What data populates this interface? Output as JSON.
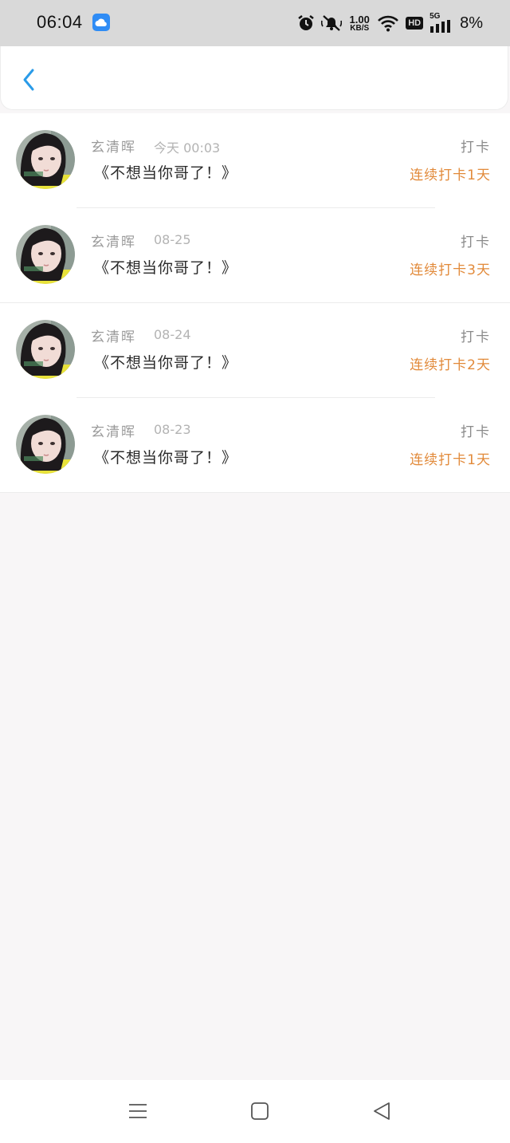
{
  "status_bar": {
    "time": "06:04",
    "net_speed_value": "1.00",
    "net_speed_unit": "KB/S",
    "hd_label": "HD",
    "signal_label": "5G",
    "battery": "8%",
    "icons": [
      "weather-icon",
      "alarm-icon",
      "mute-icon",
      "wifi-icon",
      "signal-icon"
    ]
  },
  "nav": {
    "back_icon": "chevron-left-icon",
    "accent": "#2a9be8"
  },
  "entries": [
    {
      "user": "玄清晖",
      "time": "今天 00:03",
      "title": "《不想当你哥了！》",
      "tag": "打卡",
      "streak": "连续打卡1天"
    },
    {
      "user": "玄清晖",
      "time": "08-25",
      "title": "《不想当你哥了！》",
      "tag": "打卡",
      "streak": "连续打卡3天"
    },
    {
      "user": "玄清晖",
      "time": "08-24",
      "title": "《不想当你哥了！》",
      "tag": "打卡",
      "streak": "连续打卡2天"
    },
    {
      "user": "玄清晖",
      "time": "08-23",
      "title": "《不想当你哥了！》",
      "tag": "打卡",
      "streak": "连续打卡1天"
    }
  ],
  "colors": {
    "streak": "#e28a3a",
    "name": "#9a9a9a",
    "title": "#2a2a2a"
  },
  "system_nav": [
    "menu-icon",
    "home-icon",
    "back-triangle-icon"
  ]
}
